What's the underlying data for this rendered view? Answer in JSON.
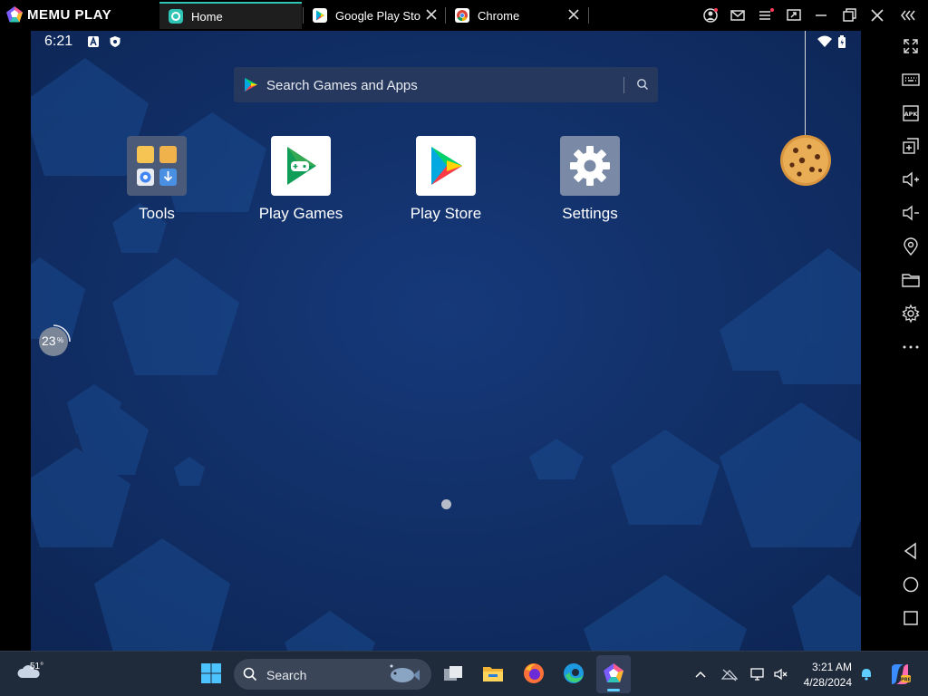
{
  "app": {
    "brand": "MEMU PLAY",
    "tabs": [
      {
        "label": "Home",
        "icon": "memu-home-icon",
        "active": true
      },
      {
        "label": "Google Play Store",
        "icon": "play-store-icon",
        "active": false
      },
      {
        "label": "Chrome",
        "icon": "chrome-icon",
        "active": false
      }
    ],
    "window_buttons": [
      "account-icon",
      "mail-icon",
      "menu-icon",
      "screen-share-icon",
      "minimize-icon",
      "restore-icon",
      "close-icon",
      "collapse-icon"
    ]
  },
  "android": {
    "status_bar": {
      "time": "6:21",
      "icons": [
        "notification-a-icon",
        "shield-icon"
      ],
      "right_icons": [
        "wifi-icon",
        "battery-icon"
      ]
    },
    "search": {
      "placeholder": "Search Games and Apps"
    },
    "apps": [
      {
        "label": "Tools",
        "icon": "tools-folder-icon"
      },
      {
        "label": "Play Games",
        "icon": "play-games-icon"
      },
      {
        "label": "Play Store",
        "icon": "play-store-icon"
      },
      {
        "label": "Settings",
        "icon": "settings-gear-icon"
      }
    ],
    "widget": {
      "value": "23",
      "unit": "%"
    },
    "page_indicator": {
      "pages": 1,
      "current": 1
    }
  },
  "sidebar": {
    "buttons": [
      "fullscreen-icon",
      "keyboard-mapping-icon",
      "apk-install-icon",
      "multi-instance-icon",
      "volume-up-icon",
      "volume-down-icon",
      "location-icon",
      "folder-icon",
      "settings-icon",
      "more-icon"
    ],
    "nav": [
      "back-icon",
      "home-circle-icon",
      "recents-icon"
    ]
  },
  "taskbar": {
    "weather": {
      "temp": "51°"
    },
    "search": {
      "label": "Search"
    },
    "pinned": [
      "start-icon",
      "task-view-icon",
      "file-explorer-icon",
      "firefox-icon",
      "edge-icon",
      "memu-icon"
    ],
    "tray": [
      "chevron-up-icon",
      "network-off-icon",
      "display-icon",
      "volume-muted-icon"
    ],
    "clock": {
      "time": "3:21 AM",
      "date": "4/28/2024"
    },
    "colors": {
      "accent": "#60cdff",
      "taskbar_bg": "#1f2a3a"
    }
  }
}
